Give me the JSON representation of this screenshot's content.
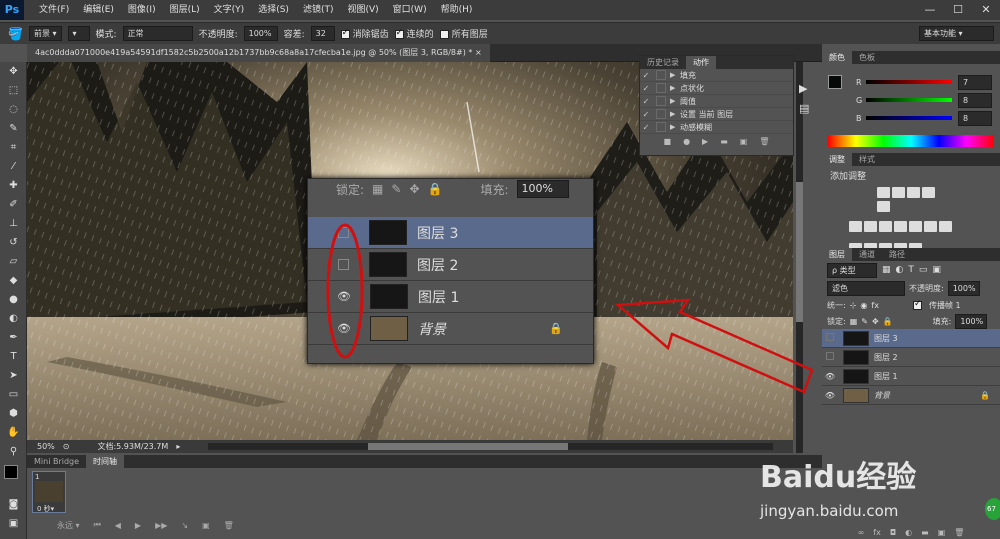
{
  "menubar": {
    "logo": "Ps",
    "items": [
      "文件(F)",
      "编辑(E)",
      "图像(I)",
      "图层(L)",
      "文字(Y)",
      "选择(S)",
      "滤镜(T)",
      "视图(V)",
      "窗口(W)",
      "帮助(H)"
    ],
    "min": "—",
    "max": "☐",
    "close": "✕"
  },
  "options": {
    "fill_source": "前景",
    "mode_label": "模式:",
    "mode_value": "正常",
    "opacity_label": "不透明度:",
    "opacity_value": "100%",
    "tolerance_label": "容差:",
    "tolerance_value": "32",
    "antialias": "消除锯齿",
    "contiguous": "连续的",
    "all_layers": "所有图层",
    "workspace": "基本功能"
  },
  "doc": {
    "tab_title": "4ac0ddda071000e419a54591df1582c5b2500a12b1737bb9c68a8a17cfecba1e.jpg @ 50% (图层 3, RGB/8#) *",
    "close": "×"
  },
  "status": {
    "zoom": "50%",
    "doc_info": "文档:5.93M/23.7M"
  },
  "timeline": {
    "tabs": [
      "Mini Bridge",
      "时间轴"
    ],
    "frame_num": "1",
    "frame_delay": "0 秒▾",
    "loop": "永远"
  },
  "history": {
    "tabs": [
      "历史记录",
      "动作"
    ],
    "items": [
      "填充",
      "点状化",
      "阈值",
      "设置 当前 图层",
      "动感模糊"
    ]
  },
  "color": {
    "tabs": [
      "颜色",
      "色板"
    ],
    "r_label": "R",
    "g_label": "G",
    "b_label": "B",
    "r": "7",
    "g": "8",
    "b": "8"
  },
  "adjust": {
    "tabs": [
      "调整",
      "样式"
    ],
    "title": "添加调整"
  },
  "layers": {
    "tabs": [
      "图层",
      "通道",
      "路径"
    ],
    "kind": "ρ 类型",
    "blend": "滤色",
    "opacity_label": "不透明度:",
    "opacity": "100%",
    "unify": "统一:",
    "propagate": "传播帧 1",
    "lock_label": "锁定:",
    "fill_label": "填充:",
    "fill": "100%",
    "rows": [
      {
        "name": "图层 3",
        "visible": false,
        "selected": true
      },
      {
        "name": "图层 2",
        "visible": false,
        "selected": false
      },
      {
        "name": "图层 1",
        "visible": true,
        "selected": false
      },
      {
        "name": "背景",
        "visible": true,
        "selected": false,
        "locked": true
      }
    ]
  },
  "zoom": {
    "lock_label": "锁定:",
    "fill_label": "填充:",
    "fill": "100%",
    "rows": [
      {
        "name": "图层 3",
        "visible": false,
        "selected": true
      },
      {
        "name": "图层 2",
        "visible": false,
        "selected": false
      },
      {
        "name": "图层 1",
        "visible": true,
        "selected": false
      },
      {
        "name": "背景",
        "visible": true,
        "selected": false,
        "locked": true
      }
    ]
  },
  "watermark": {
    "brand": "Baidu经验",
    "url": "jingyan.baidu.com",
    "badge": "67"
  },
  "colors": {
    "ps_blue": "#31a8ff",
    "selected_row": "#5a6a8c",
    "annotation_red": "#d01010"
  }
}
